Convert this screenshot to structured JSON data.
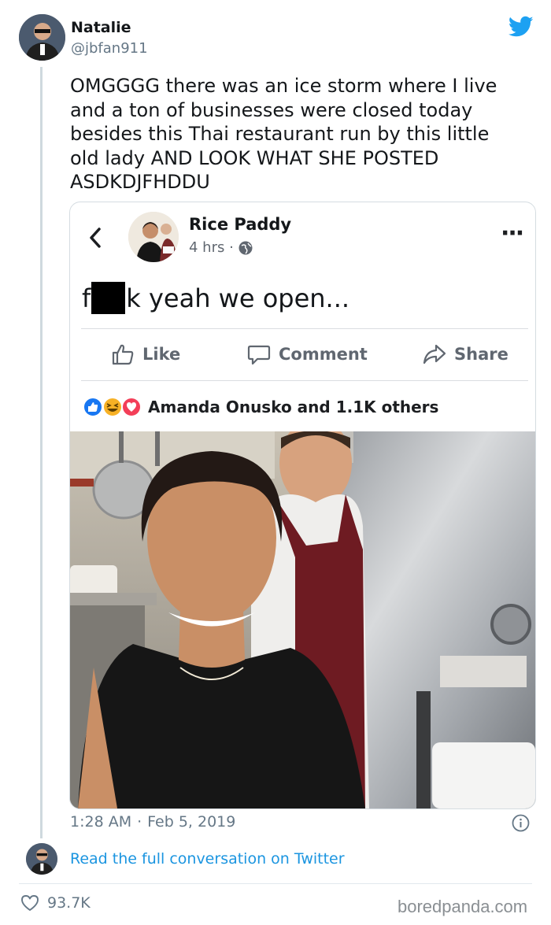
{
  "tweet": {
    "author_name": "Natalie",
    "author_handle": "@jbfan911",
    "text_lines": [
      "OMGGGG there was an ice storm where I live",
      "and a ton of businesses were closed today",
      "besides this Thai restaurant run by this little",
      "old lady AND LOOK WHAT SHE POSTED",
      "ASDKDJFHDDU"
    ],
    "time": "1:28 AM",
    "separator": "·",
    "date": "Feb 5, 2019",
    "read_more": "Read the full conversation on Twitter",
    "like_count": "93.7K",
    "brand_color": "#1da1f2"
  },
  "facebook_post": {
    "page_name": "Rice Paddy",
    "age": "4 hrs ·",
    "post_text_start": "f",
    "post_text_end": "k yeah we open...",
    "actions": {
      "like": "Like",
      "comment": "Comment",
      "share": "Share"
    },
    "reactions_text": "Amanda Onusko and 1.1K others",
    "more_icon": "···"
  },
  "watermark": "boredpanda.com"
}
